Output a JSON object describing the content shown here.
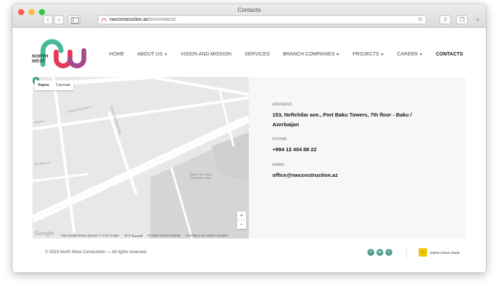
{
  "browser": {
    "title": "Contacts",
    "url_domain": "nwconstruction.az",
    "url_path": "/en/contacts/",
    "back_icon": "chevron-left-icon",
    "forward_icon": "chevron-right-icon",
    "reload_icon": "reload-icon",
    "share_icon": "share-icon",
    "tabs_icon": "tabs-icon",
    "new_tab_icon": "plus-icon"
  },
  "brand": {
    "logo_line1": "NORTH",
    "logo_line2": "WEST",
    "colors": {
      "green": "#47b89a",
      "red": "#e8375a",
      "purple": "#a44a8a"
    }
  },
  "nav": {
    "items": [
      {
        "label": "HOME",
        "dropdown": false,
        "active": false
      },
      {
        "label": "ABOUT US",
        "dropdown": true,
        "active": false
      },
      {
        "label": "VISION AND MISSION",
        "dropdown": false,
        "active": false
      },
      {
        "label": "SERVICES",
        "dropdown": false,
        "active": false
      },
      {
        "label": "BRANCH COMPANIES",
        "dropdown": true,
        "active": false
      },
      {
        "label": "PROJECTS",
        "dropdown": true,
        "active": false
      },
      {
        "label": "CAREER",
        "dropdown": true,
        "active": false
      },
      {
        "label": "CONTACTS",
        "dropdown": false,
        "active": true
      }
    ]
  },
  "map": {
    "tabs": [
      "Карта",
      "Спутник"
    ],
    "active_tab": "Карта",
    "zoom_in": "+",
    "zoom_out": "−",
    "logo": "Google",
    "attribution": "Картографические данные © 2016 Google",
    "scale": "50 м",
    "terms": "Условия использования",
    "report": "Сообщить об ошибке на карте",
    "park_label": "Парк Порт Баку Port Baku Park",
    "streets": [
      "Üzeyir Hacıbəyov",
      "ebəyov",
      "Xfa Əliyeva",
      "Üzeyir Hacıbəyov küç."
    ],
    "pin_color": "#3a9d8c"
  },
  "contact": {
    "address_label": "ADDRESS",
    "address_value": "153, Neftchilar ave., Port Baku Towers, 7th floor - Baku / Azerbaijan",
    "phone_label": "PHONE",
    "phone_value": "+994 12 404 88 22",
    "email_label": "EMAIL",
    "email_value": "office@nwconstruction.az"
  },
  "footer": {
    "copyright": "© 2015 North West Constuction — All rights reserved.",
    "social": [
      {
        "icon": "facebook-icon",
        "glyph": "f"
      },
      {
        "icon": "linkedin-icon",
        "glyph": "in"
      },
      {
        "icon": "twitter-icon",
        "glyph": "t"
      }
    ],
    "studio_text": "Jephon Imavio Studio",
    "social_color": "#4f9d91"
  }
}
